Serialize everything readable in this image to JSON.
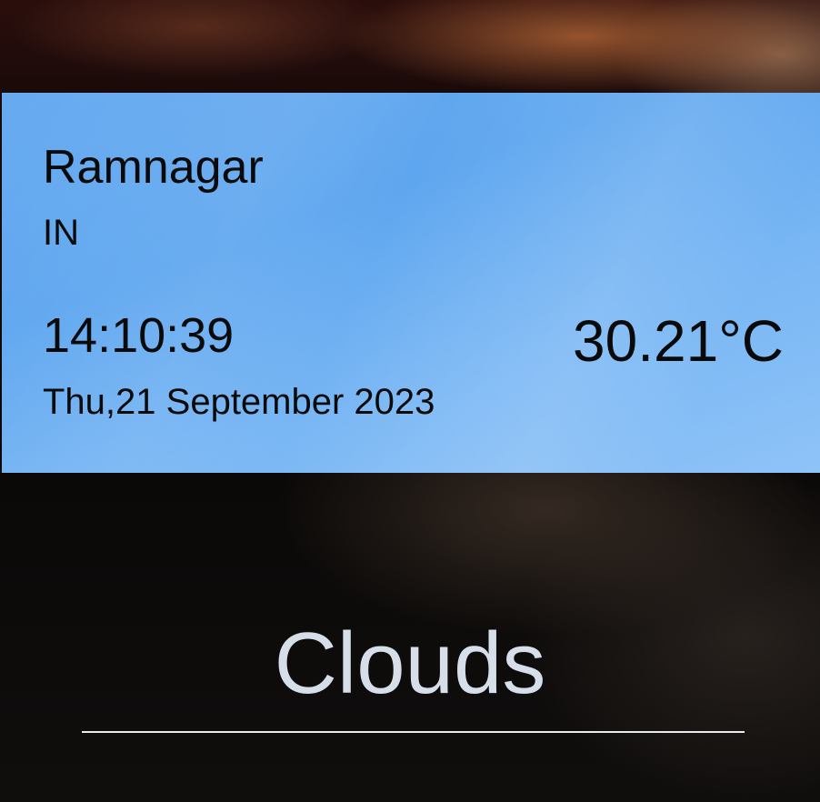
{
  "location": {
    "city": "Ramnagar",
    "country": "IN"
  },
  "clock": {
    "time": "14:10:39",
    "date": "Thu,21 September 2023"
  },
  "weather": {
    "temperature": "30.21°C",
    "condition": "Clouds"
  },
  "colors": {
    "card_background": "#67aaf0",
    "condition_text": "#d6deea"
  }
}
